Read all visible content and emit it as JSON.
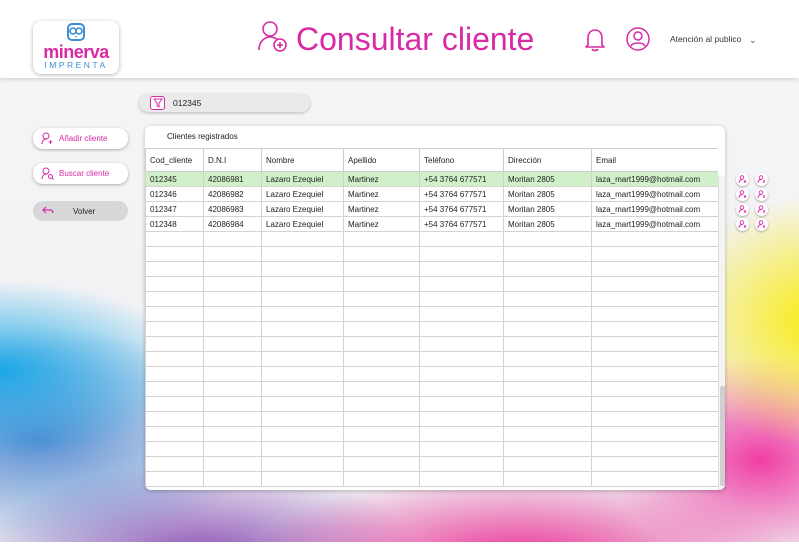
{
  "header": {
    "logo_brand": "minerva",
    "logo_sub": "IMPRENTA",
    "page_title": "Consultar cliente",
    "user_role": "Atención al publico"
  },
  "search": {
    "value": "012345"
  },
  "sidebar": {
    "add_label": "Añadir cliente",
    "search_label": "Buscar cliente",
    "back_label": "Volver"
  },
  "panel": {
    "title": "Clientes registrados",
    "columns": [
      "Cod_cliente",
      "D.N.I",
      "Nombre",
      "Apellido",
      "Teléfono",
      "Dirección",
      "Email"
    ],
    "rows": [
      [
        "012345",
        "42086981",
        "Lazaro Ezequiel",
        "Martinez",
        "+54 3764 677571",
        "Moritan 2805",
        "laza_mart1999@hotmail.com"
      ],
      [
        "012346",
        "42086982",
        "Lazaro Ezequiel",
        "Martinez",
        "+54 3764 677571",
        "Moritan 2805",
        "laza_mart1999@hotmail.com"
      ],
      [
        "012347",
        "42086983",
        "Lazaro Ezequiel",
        "Martinez",
        "+54 3764 677571",
        "Moritan 2805",
        "laza_mart1999@hotmail.com"
      ],
      [
        "012348",
        "42086984",
        "Lazaro Ezequiel",
        "Martinez",
        "+54 3764 677571",
        "Moritan 2805",
        "laza_mart1999@hotmail.com"
      ]
    ],
    "selected_row": 0
  },
  "colors": {
    "accent": "#d92aa6",
    "selected_row": "#cff0c9",
    "logo_blue": "#3a8fd8"
  }
}
